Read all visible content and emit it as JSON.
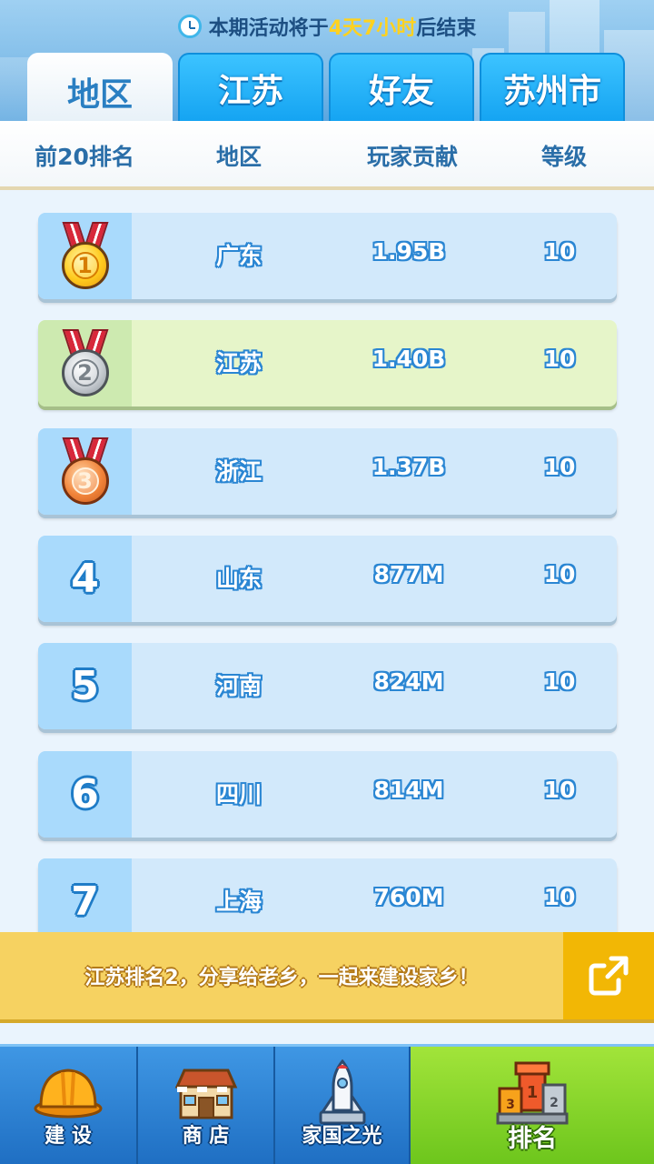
{
  "header": {
    "timer": {
      "prefix": "本期活动将于",
      "highlight": "4天7小时",
      "suffix": "后结束",
      "highlight_color": "#ffd21f"
    },
    "tabs": [
      {
        "label": "地区",
        "active": true
      },
      {
        "label": "江苏",
        "active": false
      },
      {
        "label": "好友",
        "active": false
      },
      {
        "label": "苏州市",
        "active": false
      }
    ]
  },
  "columns": {
    "rank": "前20排名",
    "region": "地区",
    "contribution": "玩家贡献",
    "level": "等级"
  },
  "leaderboard": [
    {
      "rank": "1",
      "medal": "gold",
      "region": "广东",
      "contribution": "1.95B",
      "level": "10",
      "highlighted": false
    },
    {
      "rank": "2",
      "medal": "silver",
      "region": "江苏",
      "contribution": "1.40B",
      "level": "10",
      "highlighted": true
    },
    {
      "rank": "3",
      "medal": "bronze",
      "region": "浙江",
      "contribution": "1.37B",
      "level": "10",
      "highlighted": false
    },
    {
      "rank": "4",
      "medal": null,
      "region": "山东",
      "contribution": "877M",
      "level": "10",
      "highlighted": false
    },
    {
      "rank": "5",
      "medal": null,
      "region": "河南",
      "contribution": "824M",
      "level": "10",
      "highlighted": false
    },
    {
      "rank": "6",
      "medal": null,
      "region": "四川",
      "contribution": "814M",
      "level": "10",
      "highlighted": false
    },
    {
      "rank": "7",
      "medal": null,
      "region": "上海",
      "contribution": "760M",
      "level": "10",
      "highlighted": false
    }
  ],
  "share": {
    "text": "江苏排名2，分享给老乡，一起来建设家乡！",
    "icon": "share-icon"
  },
  "nav": [
    {
      "label": "建 设",
      "icon": "hard-hat-icon",
      "active": false
    },
    {
      "label": "商 店",
      "icon": "shop-icon",
      "active": false
    },
    {
      "label": "家国之光",
      "icon": "rocket-icon",
      "active": false
    },
    {
      "label": "排名",
      "icon": "podium-icon",
      "active": true
    }
  ],
  "colors": {
    "tab_active_text": "#2a7fc2",
    "tab_inactive_bg": "#15a4f2",
    "row_bg": "#d2e9fb",
    "row_highlight_bg": "#e6f5c9",
    "share_bg": "#f6d261",
    "nav_active_bg": "#6cc51c"
  }
}
